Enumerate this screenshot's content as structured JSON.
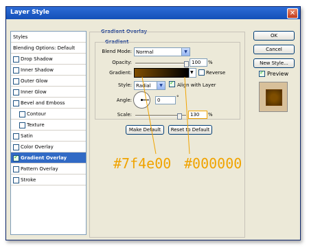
{
  "window": {
    "title": "Layer Style",
    "close_glyph": "✕"
  },
  "sidebar": {
    "header": "Styles",
    "blending": "Blending Options: Default",
    "items": [
      {
        "label": "Drop Shadow",
        "checked": false,
        "indent": false,
        "selected": false
      },
      {
        "label": "Inner Shadow",
        "checked": false,
        "indent": false,
        "selected": false
      },
      {
        "label": "Outer Glow",
        "checked": false,
        "indent": false,
        "selected": false
      },
      {
        "label": "Inner Glow",
        "checked": false,
        "indent": false,
        "selected": false
      },
      {
        "label": "Bevel and Emboss",
        "checked": false,
        "indent": false,
        "selected": false
      },
      {
        "label": "Contour",
        "checked": false,
        "indent": true,
        "selected": false
      },
      {
        "label": "Texture",
        "checked": false,
        "indent": true,
        "selected": false
      },
      {
        "label": "Satin",
        "checked": false,
        "indent": false,
        "selected": false
      },
      {
        "label": "Color Overlay",
        "checked": false,
        "indent": false,
        "selected": false
      },
      {
        "label": "Gradient Overlay",
        "checked": true,
        "indent": false,
        "selected": true
      },
      {
        "label": "Pattern Overlay",
        "checked": false,
        "indent": false,
        "selected": false
      },
      {
        "label": "Stroke",
        "checked": false,
        "indent": false,
        "selected": false
      }
    ]
  },
  "panel": {
    "title": "Gradient Overlay",
    "subtitle": "Gradient",
    "blend_mode_label": "Blend Mode:",
    "blend_mode_value": "Normal",
    "opacity_label": "Opacity:",
    "opacity_value": "100",
    "opacity_unit": "%",
    "opacity_fraction": 1.0,
    "gradient_label": "Gradient:",
    "reverse_label": "Reverse",
    "style_label": "Style:",
    "style_value": "Radial",
    "align_label": "Align with Layer",
    "align_checked": true,
    "angle_label": "Angle:",
    "angle_value": "0",
    "angle_unit": "°",
    "scale_label": "Scale:",
    "scale_value": "130",
    "scale_unit": "%",
    "scale_fraction": 0.87,
    "make_default": "Make Default",
    "reset_default": "Reset to Default"
  },
  "buttons": {
    "ok": "OK",
    "cancel": "Cancel",
    "new_style": "New Style...",
    "preview": "Preview",
    "preview_checked": true
  },
  "annotations": {
    "left": "#7f4e00",
    "right": "#000000"
  },
  "colors": {
    "accent": "#316ac5",
    "annotation": "#f0a300",
    "gradient_start": "#7f4e00",
    "gradient_end": "#000000",
    "scale_highlight": "#f0a300",
    "preview_outer": "#d8c09a",
    "preview_inner": "#7f4e00"
  }
}
